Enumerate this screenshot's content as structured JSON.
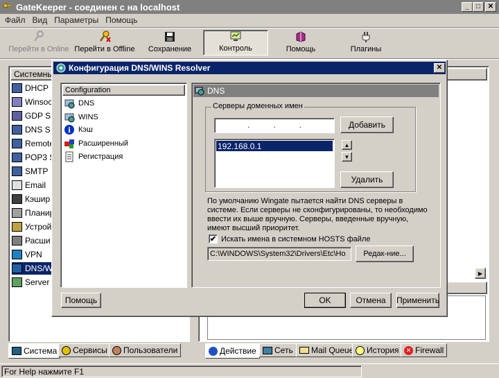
{
  "app": {
    "title": "GateKeeper - соединен с на localhost"
  },
  "menu": [
    "Файл",
    "Вид",
    "Параметры",
    "Помощь"
  ],
  "toolbar": [
    {
      "label": "Перейти в Online",
      "icon": "key-icon",
      "disabled": true
    },
    {
      "label": "Перейти в Offline",
      "icon": "key-offline-icon"
    },
    {
      "label": "Сохранение",
      "icon": "floppy-icon"
    },
    {
      "label": "Контроль",
      "icon": "monitor-icon",
      "active": true
    },
    {
      "label": "Помощь",
      "icon": "book-icon"
    },
    {
      "label": "Плагины",
      "icon": "plug-icon"
    }
  ],
  "left_panel": {
    "header": "Системны",
    "items": [
      "DHCP",
      "Winsoc",
      "GDP S",
      "DNS S",
      "Remote",
      "POP3 S",
      "SMTP",
      "Email",
      "Кэшир",
      "Планир",
      "Устрой",
      "Расши",
      "VPN",
      "DNS/W",
      "Server"
    ]
  },
  "left_tabs": [
    "Система",
    "Сервисы",
    "Пользователи"
  ],
  "right_tabs": [
    "Действие",
    "Сеть",
    "Mail Queue",
    "История",
    "Firewall"
  ],
  "status": "For Help нажмите F1",
  "dialog": {
    "title": "Конфигурация DNS/WINS Resolver",
    "tree_header": "Configuration",
    "tree_items": [
      {
        "label": "DNS",
        "icon": "dns-icon"
      },
      {
        "label": "WINS",
        "icon": "wins-icon"
      },
      {
        "label": "Кэш",
        "icon": "info-icon"
      },
      {
        "label": "Расширенный",
        "icon": "puzzle-icon"
      },
      {
        "label": "Регистрация",
        "icon": "document-icon"
      }
    ],
    "panel_header": "DNS",
    "group_label": "Серверы доменных имен",
    "ip_placeholder": ". . .",
    "servers": [
      "192.168.0.1"
    ],
    "add_label": "Добавить",
    "delete_label": "Удалить",
    "description": "По умолчанию Wingate пытается найти DNS серверы в системе. Если серверы не сконфигурированы, то необходимо ввести их выше вручную. Серверы, введенные вручную, имеют высший приоритет.",
    "hosts_checkbox_label": "Искать имена в системном HOSTS файле",
    "hosts_checked": true,
    "hosts_path": "C:\\WINDOWS\\System32\\Drivers\\Etc\\Ho",
    "edit_label": "Редак-ние...",
    "help_label": "Помощь",
    "ok_label": "OK",
    "cancel_label": "Отмена",
    "apply_label": "Применить"
  }
}
